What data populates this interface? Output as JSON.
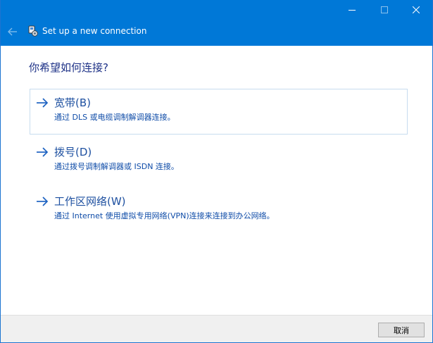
{
  "window": {
    "title": "Set up a new connection",
    "controls": {
      "minimize": "minimize-icon",
      "maximize": "maximize-icon",
      "close": "close-icon"
    },
    "accent_color": "#0078d7"
  },
  "main": {
    "heading": "你希望如何连接?",
    "options": [
      {
        "label": "宽带(B)",
        "description": "通过 DLS 或电缆调制解调器连接。",
        "icon": "arrow-right-icon",
        "selected": true
      },
      {
        "label": "拨号(D)",
        "description": "通过拨号调制解调器或 ISDN 连接。",
        "icon": "arrow-right-icon",
        "selected": false
      },
      {
        "label": "工作区网络(W)",
        "description": "通过 Internet 使用虚拟专用网络(VPN)连接来连接到办公网络。",
        "icon": "arrow-right-icon",
        "selected": false
      }
    ]
  },
  "footer": {
    "cancel_label": "取消"
  }
}
